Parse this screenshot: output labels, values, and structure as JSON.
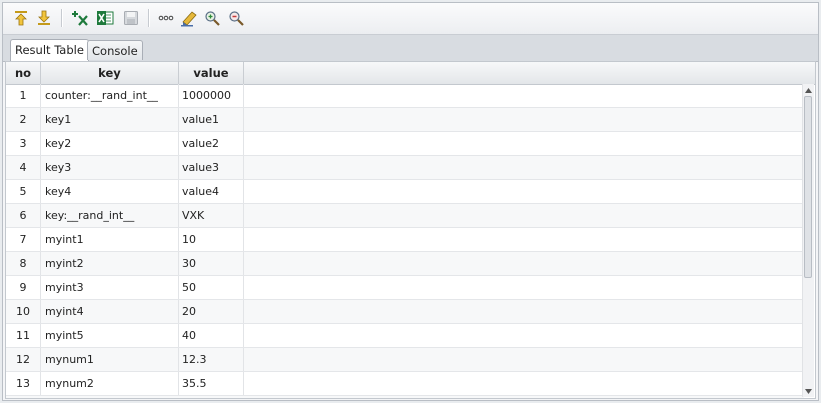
{
  "toolbar": {
    "icons": [
      "move-up-icon",
      "move-down-icon",
      "clear-icon",
      "excel-export-icon",
      "save-icon",
      "more-icon",
      "edit-icon",
      "zoom-in-icon",
      "zoom-out-icon"
    ]
  },
  "tabs": [
    {
      "label": "Result Table",
      "active": true
    },
    {
      "label": "Console",
      "active": false
    }
  ],
  "table": {
    "columns": [
      "no",
      "key",
      "value"
    ],
    "rows": [
      {
        "no": "1",
        "key": "counter:__rand_int__",
        "value": "1000000"
      },
      {
        "no": "2",
        "key": "key1",
        "value": "value1"
      },
      {
        "no": "3",
        "key": "key2",
        "value": "value2"
      },
      {
        "no": "4",
        "key": "key3",
        "value": "value3"
      },
      {
        "no": "5",
        "key": "key4",
        "value": "value4"
      },
      {
        "no": "6",
        "key": "key:__rand_int__",
        "value": "VXK"
      },
      {
        "no": "7",
        "key": "myint1",
        "value": "10"
      },
      {
        "no": "8",
        "key": "myint2",
        "value": "30"
      },
      {
        "no": "9",
        "key": "myint3",
        "value": "50"
      },
      {
        "no": "10",
        "key": "myint4",
        "value": "20"
      },
      {
        "no": "11",
        "key": "myint5",
        "value": "40"
      },
      {
        "no": "12",
        "key": "mynum1",
        "value": "12.3"
      },
      {
        "no": "13",
        "key": "mynum2",
        "value": "35.5"
      }
    ]
  },
  "colors": {
    "excel_green": "#1e7a3c",
    "accent_yellow": "#e0b020"
  }
}
